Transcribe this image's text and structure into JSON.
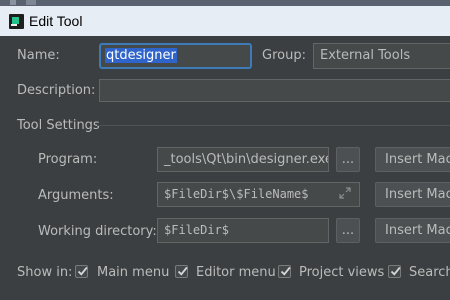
{
  "window": {
    "title": "Edit Tool"
  },
  "form": {
    "name_label": "Name:",
    "name_value": "qtdesigner",
    "group_label": "Group:",
    "group_value": "External Tools",
    "description_label": "Description:",
    "description_value": ""
  },
  "tool_settings": {
    "section_title": "Tool Settings",
    "program_label": "Program:",
    "program_value": "_tools\\Qt\\bin\\designer.exe",
    "arguments_label": "Arguments:",
    "arguments_value": "$FileDir$\\$FileName$",
    "working_dir_label": "Working directory:",
    "working_dir_value": "$FileDir$",
    "browse_label": "...",
    "insert_macro_label": "Insert Macro..."
  },
  "show_in": {
    "label": "Show in:",
    "options": [
      {
        "label": "Main menu",
        "checked": true
      },
      {
        "label": "Editor menu",
        "checked": true
      },
      {
        "label": "Project views",
        "checked": true
      },
      {
        "label": "Search results",
        "checked": true
      }
    ]
  },
  "colors": {
    "background": "#3c3f41",
    "titlebar": "#e6edf4",
    "focus_border": "#3d7bb8",
    "selection": "#2f65ca"
  },
  "icons": {
    "app": "pycharm-icon",
    "expand": "expand-icon",
    "check": "check-icon"
  }
}
